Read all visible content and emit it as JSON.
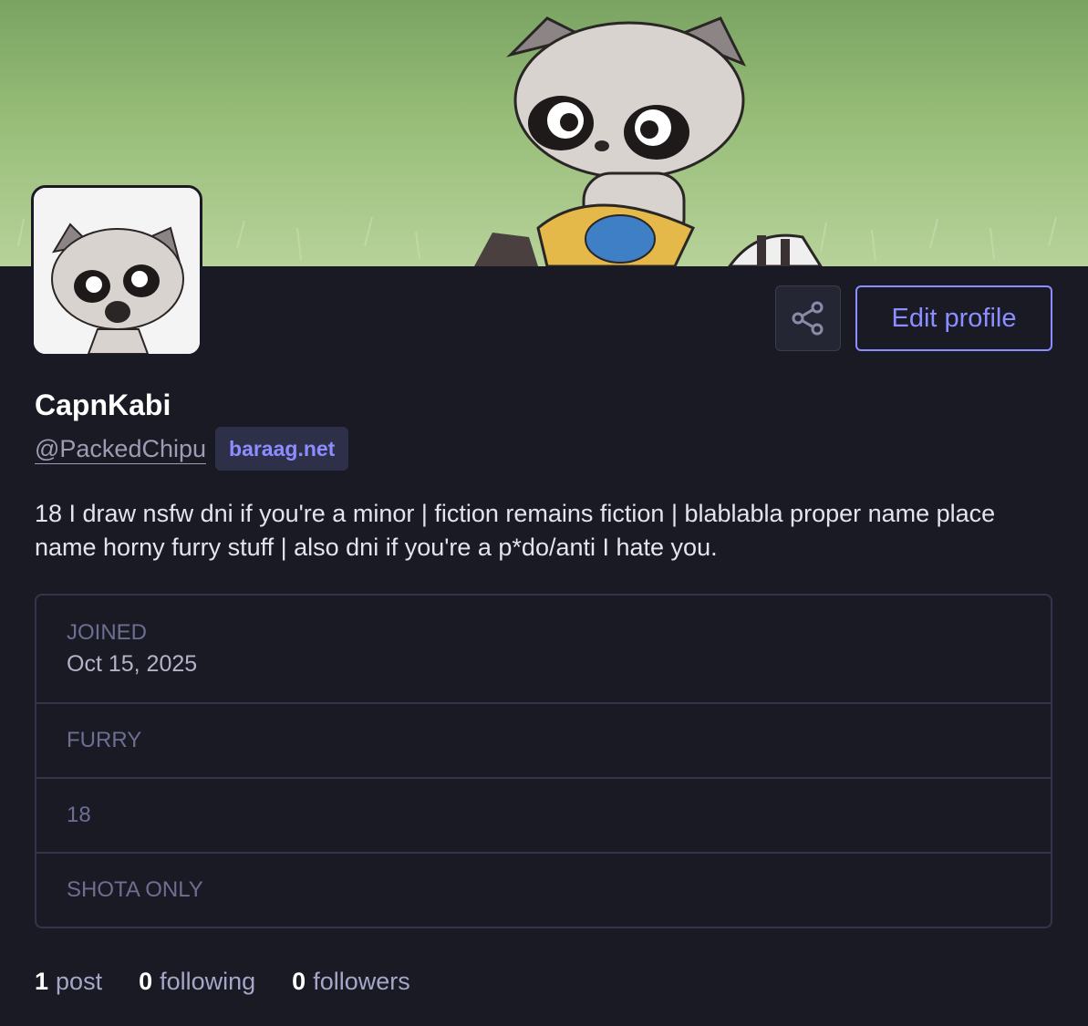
{
  "profile": {
    "display_name": "CapnKabi",
    "handle": "@PackedChipu",
    "domain": "baraag.net",
    "bio": "18 I draw nsfw dni if you're a minor | fiction remains fiction | blablabla proper name place name horny furry stuff | also dni if you're a p*do/anti I hate you."
  },
  "actions": {
    "share_icon": "share-icon",
    "edit_label": "Edit profile"
  },
  "fields": [
    {
      "label": "JOINED",
      "value": "Oct 15, 2025"
    },
    {
      "label": "FURRY",
      "value": ""
    },
    {
      "label": "18",
      "value": ""
    },
    {
      "label": "SHOTA ONLY",
      "value": ""
    }
  ],
  "stats": {
    "posts_count": "1",
    "posts_label": "post",
    "following_count": "0",
    "following_label": "following",
    "followers_count": "0",
    "followers_label": "followers"
  },
  "colors": {
    "background": "#191a24",
    "accent": "#8c8dff",
    "border": "#34354a",
    "muted": "#6e6e92"
  }
}
